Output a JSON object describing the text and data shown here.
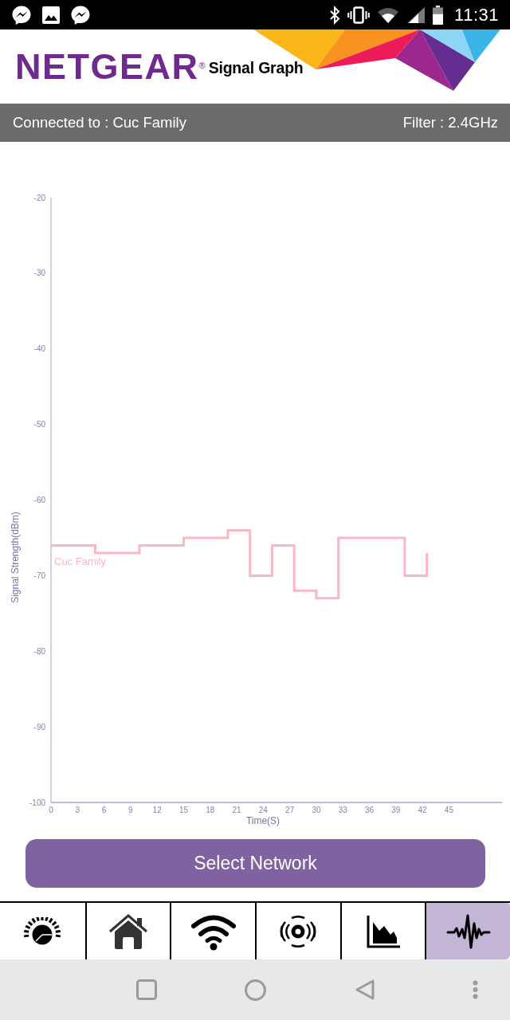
{
  "status_bar": {
    "time": "11:31"
  },
  "header": {
    "logo": "NETGEAR$^{®}$",
    "title": "Signal Graph"
  },
  "connection_bar": {
    "connected": "Connected to : Cuc Family",
    "filter": "Filter : 2.4GHz"
  },
  "signal_chart": {
    "chart_data": {
      "type": "line",
      "xlabel": "Time(S)",
      "ylabel": "Signal Strength(dBm)",
      "x": [
        0,
        5,
        5,
        10,
        10,
        15,
        15,
        20,
        20,
        22.5,
        22.5,
        25,
        25,
        27.5,
        27.5,
        30,
        30,
        32.5,
        32.5,
        40,
        40,
        42.5,
        42.5
      ],
      "series": [
        {
          "name": "Cuc Family",
          "color": "#f9b8c4",
          "values": [
            -66,
            -66,
            -67,
            -67,
            -66,
            -66,
            -65,
            -65,
            -64,
            -64,
            -70,
            -70,
            -66,
            -66,
            -72,
            -72,
            -73,
            -73,
            -65,
            -65,
            -70,
            -70,
            -67
          ]
        }
      ],
      "xlim": [
        0,
        51
      ],
      "ylim": [
        -100,
        -20
      ],
      "xticks": [
        0,
        3,
        6,
        9,
        12,
        15,
        18,
        21,
        24,
        27,
        30,
        33,
        36,
        39,
        42,
        45
      ],
      "yticks": [
        -20,
        -30,
        -40,
        -50,
        -60,
        -70,
        -80,
        -90,
        -100
      ]
    }
  },
  "select_button": {
    "label": "Select Network"
  },
  "tab_bar": {
    "tabs": [
      {
        "kind": "gauge",
        "selected": false
      },
      {
        "kind": "house",
        "selected": false
      },
      {
        "kind": "wifi",
        "selected": false
      },
      {
        "kind": "radar",
        "selected": false
      },
      {
        "kind": "area-chart",
        "selected": false
      },
      {
        "kind": "waveform",
        "selected": true
      }
    ]
  }
}
